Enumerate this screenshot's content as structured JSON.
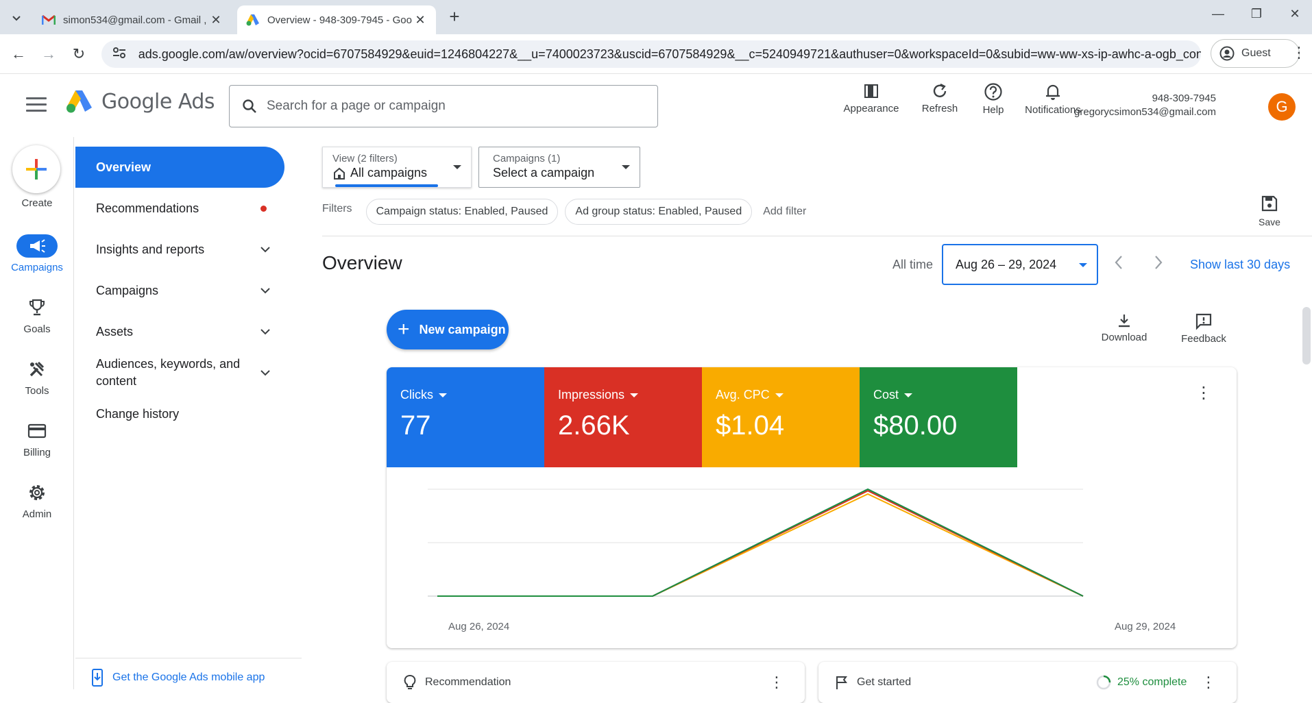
{
  "browser": {
    "tabs": [
      {
        "title": "simon534@gmail.com - Gmail ,",
        "active": false,
        "icon": "gmail-icon"
      },
      {
        "title": "Overview - 948-309-7945 - Goo",
        "active": true,
        "icon": "google-ads-icon"
      }
    ],
    "url": "ads.google.com/aw/overview?ocid=6707584929&euid=1246804227&__u=7400023723&uscid=6707584929&__c=5240949721&authuser=0&workspaceId=0&subid=ww-ww-xs-ip-awhc-a-ogb_con...",
    "profile_label": "Guest"
  },
  "header": {
    "brand": "Google Ads",
    "search_placeholder": "Search for a page or campaign",
    "actions": [
      {
        "label": "Appearance",
        "icon": "appearance-icon"
      },
      {
        "label": "Refresh",
        "icon": "refresh-icon"
      },
      {
        "label": "Help",
        "icon": "help-icon"
      },
      {
        "label": "Notifications",
        "icon": "bell-icon"
      }
    ],
    "account_id": "948-309-7945",
    "account_email": "gregorycsimon534@gmail.com",
    "avatar_letter": "G"
  },
  "rail": {
    "create_label": "Create",
    "items": [
      {
        "label": "Campaigns",
        "icon": "megaphone-icon",
        "active": true
      },
      {
        "label": "Goals",
        "icon": "trophy-icon",
        "active": false
      },
      {
        "label": "Tools",
        "icon": "tools-icon",
        "active": false
      },
      {
        "label": "Billing",
        "icon": "credit-card-icon",
        "active": false
      },
      {
        "label": "Admin",
        "icon": "gear-icon",
        "active": false
      }
    ]
  },
  "nav": {
    "items": [
      {
        "label": "Overview",
        "active": true
      },
      {
        "label": "Recommendations",
        "badge": "red-dot"
      },
      {
        "label": "Insights and reports",
        "expandable": true
      },
      {
        "label": "Campaigns",
        "expandable": true
      },
      {
        "label": "Assets",
        "expandable": true
      },
      {
        "label": "Audiences, keywords, and content",
        "expandable": true
      },
      {
        "label": "Change history"
      }
    ],
    "mobile_app_link": "Get the Google Ads mobile app"
  },
  "main": {
    "view_filter": {
      "sub": "View (2 filters)",
      "value": "All campaigns"
    },
    "campaign_filter": {
      "sub": "Campaigns (1)",
      "value": "Select a campaign"
    },
    "filters_label": "Filters",
    "filter_chips": [
      "Campaign status: Enabled, Paused",
      "Ad group status: Enabled, Paused"
    ],
    "add_filter": "Add filter",
    "save_label": "Save",
    "title": "Overview",
    "all_time_label": "All time",
    "date_range": "Aug 26 – 29, 2024",
    "show_last_30": "Show last 30 days",
    "new_campaign_label": "New campaign",
    "download_label": "Download",
    "feedback_label": "Feedback",
    "metrics": [
      {
        "name": "Clicks",
        "value": "77",
        "color": "#1a73e8"
      },
      {
        "name": "Impressions",
        "value": "2.66K",
        "color": "#d93025"
      },
      {
        "name": "Avg. CPC",
        "value": "$1.04",
        "color": "#f9ab00"
      },
      {
        "name": "Cost",
        "value": "$80.00",
        "color": "#1e8e3e"
      }
    ],
    "recommendation_card": "Recommendation",
    "get_started_card": "Get started",
    "get_started_progress": "25% complete"
  },
  "chart_data": {
    "type": "line",
    "x": [
      "Aug 26, 2024",
      "Aug 27, 2024",
      "Aug 28, 2024",
      "Aug 29, 2024"
    ],
    "xtick_labels": [
      "Aug 26, 2024",
      "Aug 29, 2024"
    ],
    "series": [
      {
        "name": "Clicks",
        "color": "#1a73e8",
        "values": [
          0,
          0,
          77,
          0
        ]
      },
      {
        "name": "Impressions",
        "color": "#d93025",
        "values": [
          0,
          0,
          2660,
          0
        ]
      },
      {
        "name": "Avg. CPC",
        "color": "#f9ab00",
        "values": [
          0,
          0,
          1.04,
          0
        ]
      },
      {
        "name": "Cost",
        "color": "#1e8e3e",
        "values": [
          0,
          0,
          80.0,
          0
        ]
      }
    ],
    "peak_fraction": [
      1.0,
      0.985,
      0.955,
      1.0
    ],
    "grid": true
  }
}
